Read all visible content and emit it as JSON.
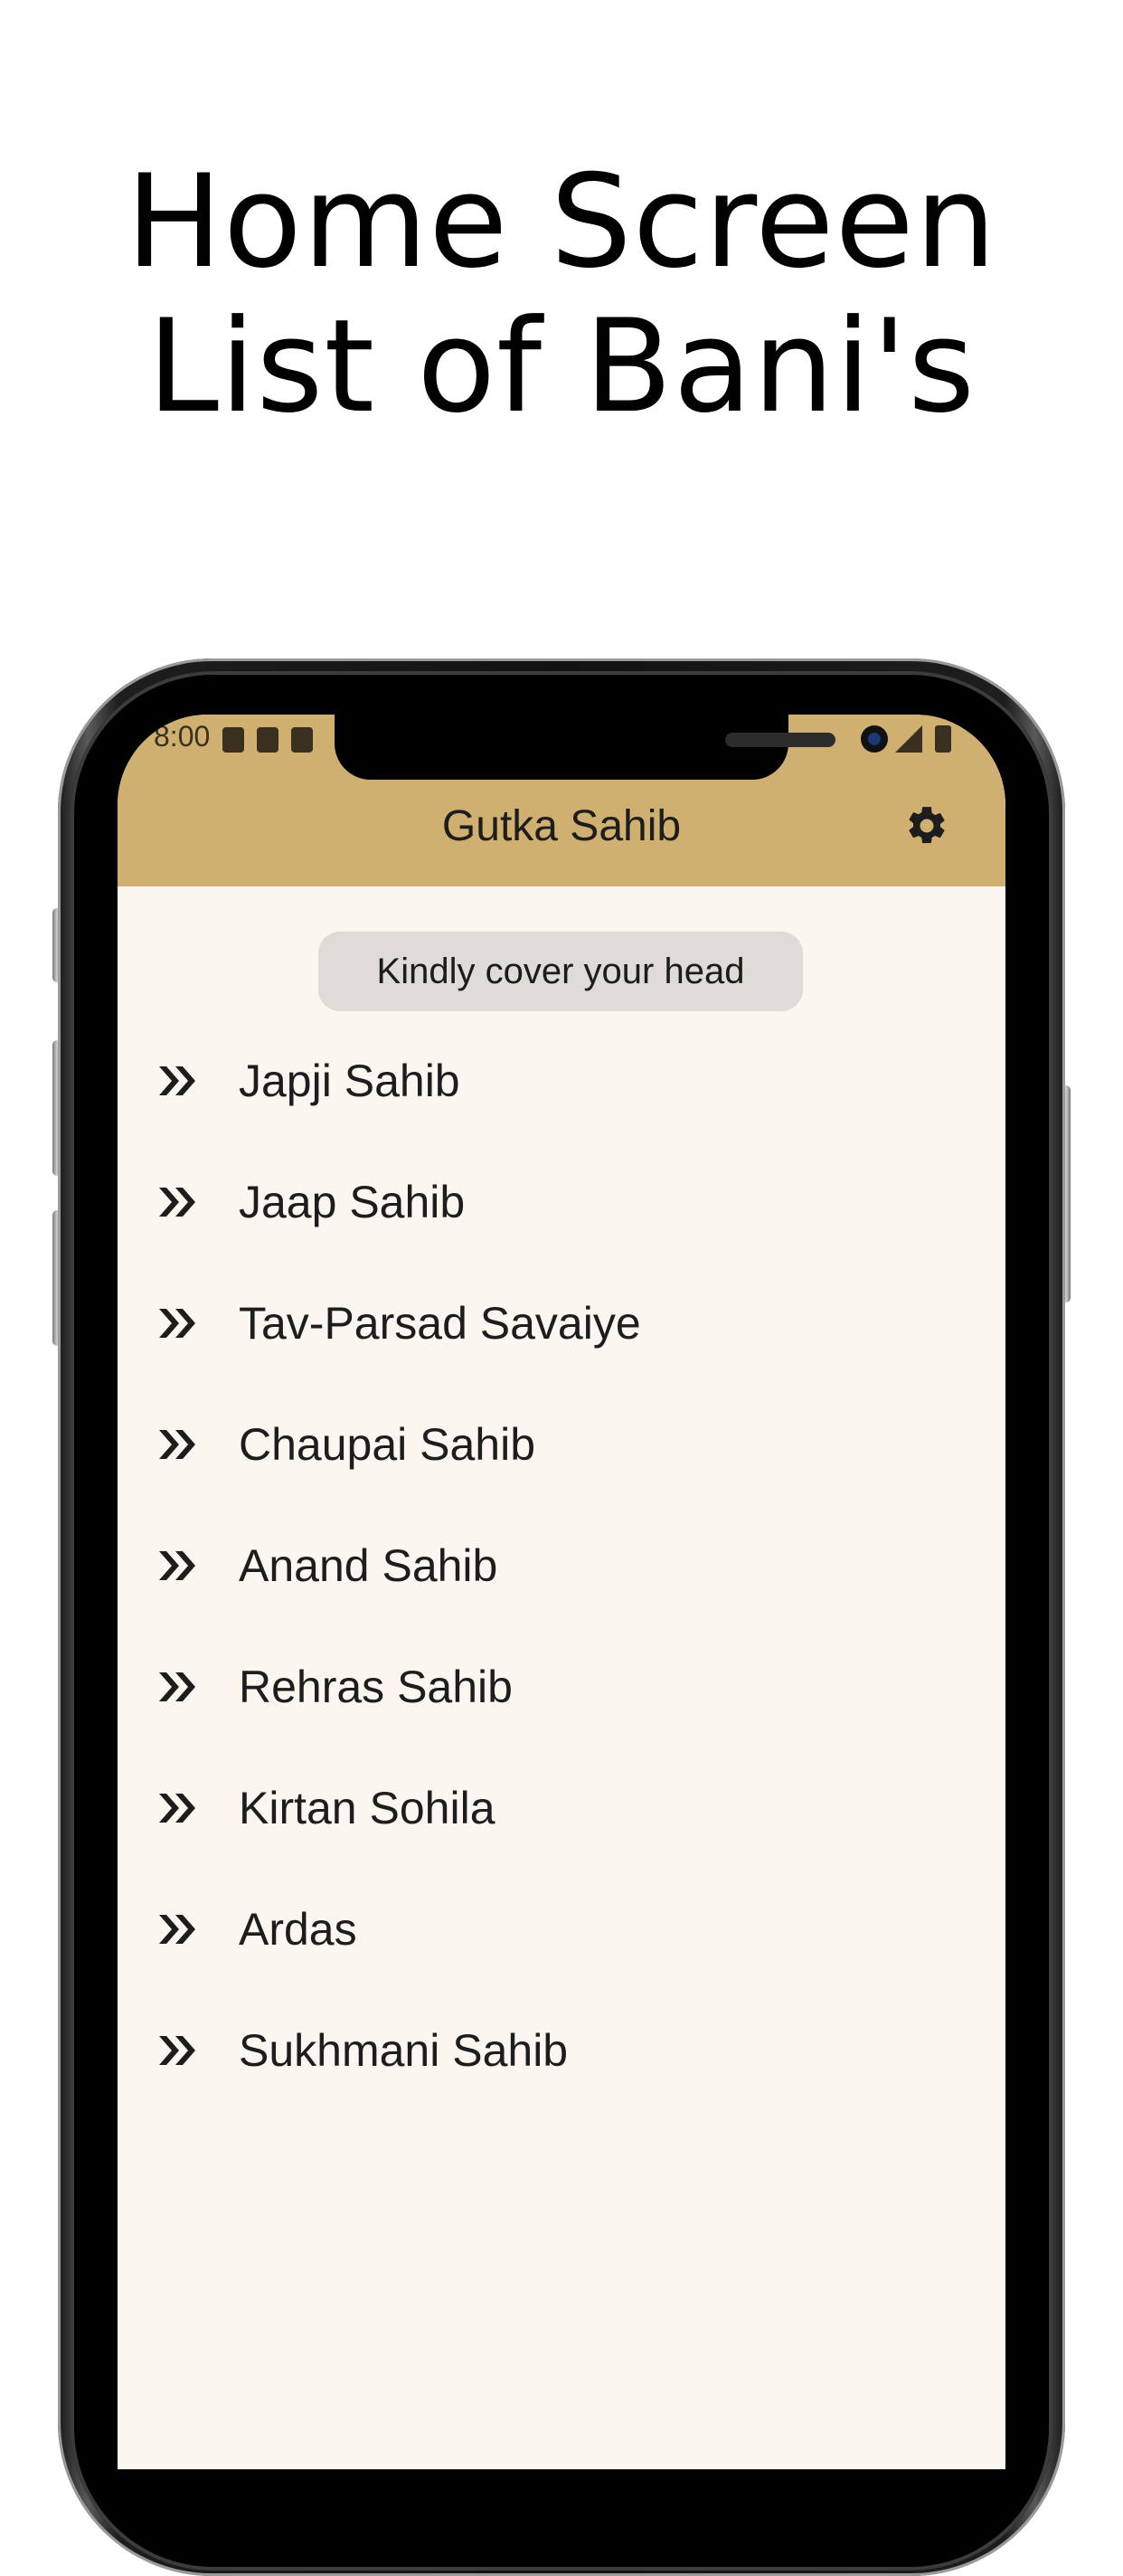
{
  "headline": {
    "line1": "Home Screen",
    "line2": "List of Bani's"
  },
  "status_bar": {
    "time": "8:00",
    "left_icons": [
      "shield-icon",
      "sd-card-icon",
      "app-notification-icon"
    ],
    "right_icons": [
      "signal-icon",
      "battery-icon"
    ]
  },
  "app_bar": {
    "title": "Gutka Sahib",
    "settings_icon": "gear-icon",
    "background_color": "#d0b070"
  },
  "toast": {
    "text": "Kindly cover your head"
  },
  "bani_list": {
    "item_icon": "double-chevron-right-icon",
    "items": [
      {
        "label": "Japji Sahib"
      },
      {
        "label": "Jaap Sahib"
      },
      {
        "label": "Tav-Parsad Savaiye"
      },
      {
        "label": "Chaupai Sahib"
      },
      {
        "label": "Anand Sahib"
      },
      {
        "label": "Rehras Sahib"
      },
      {
        "label": "Kirtan Sohila"
      },
      {
        "label": "Ardas"
      },
      {
        "label": "Sukhmani Sahib"
      }
    ]
  },
  "colors": {
    "screen_background": "#fcf6f1",
    "toast_background": "#dfdbd6",
    "text": "#1d1d1d"
  }
}
